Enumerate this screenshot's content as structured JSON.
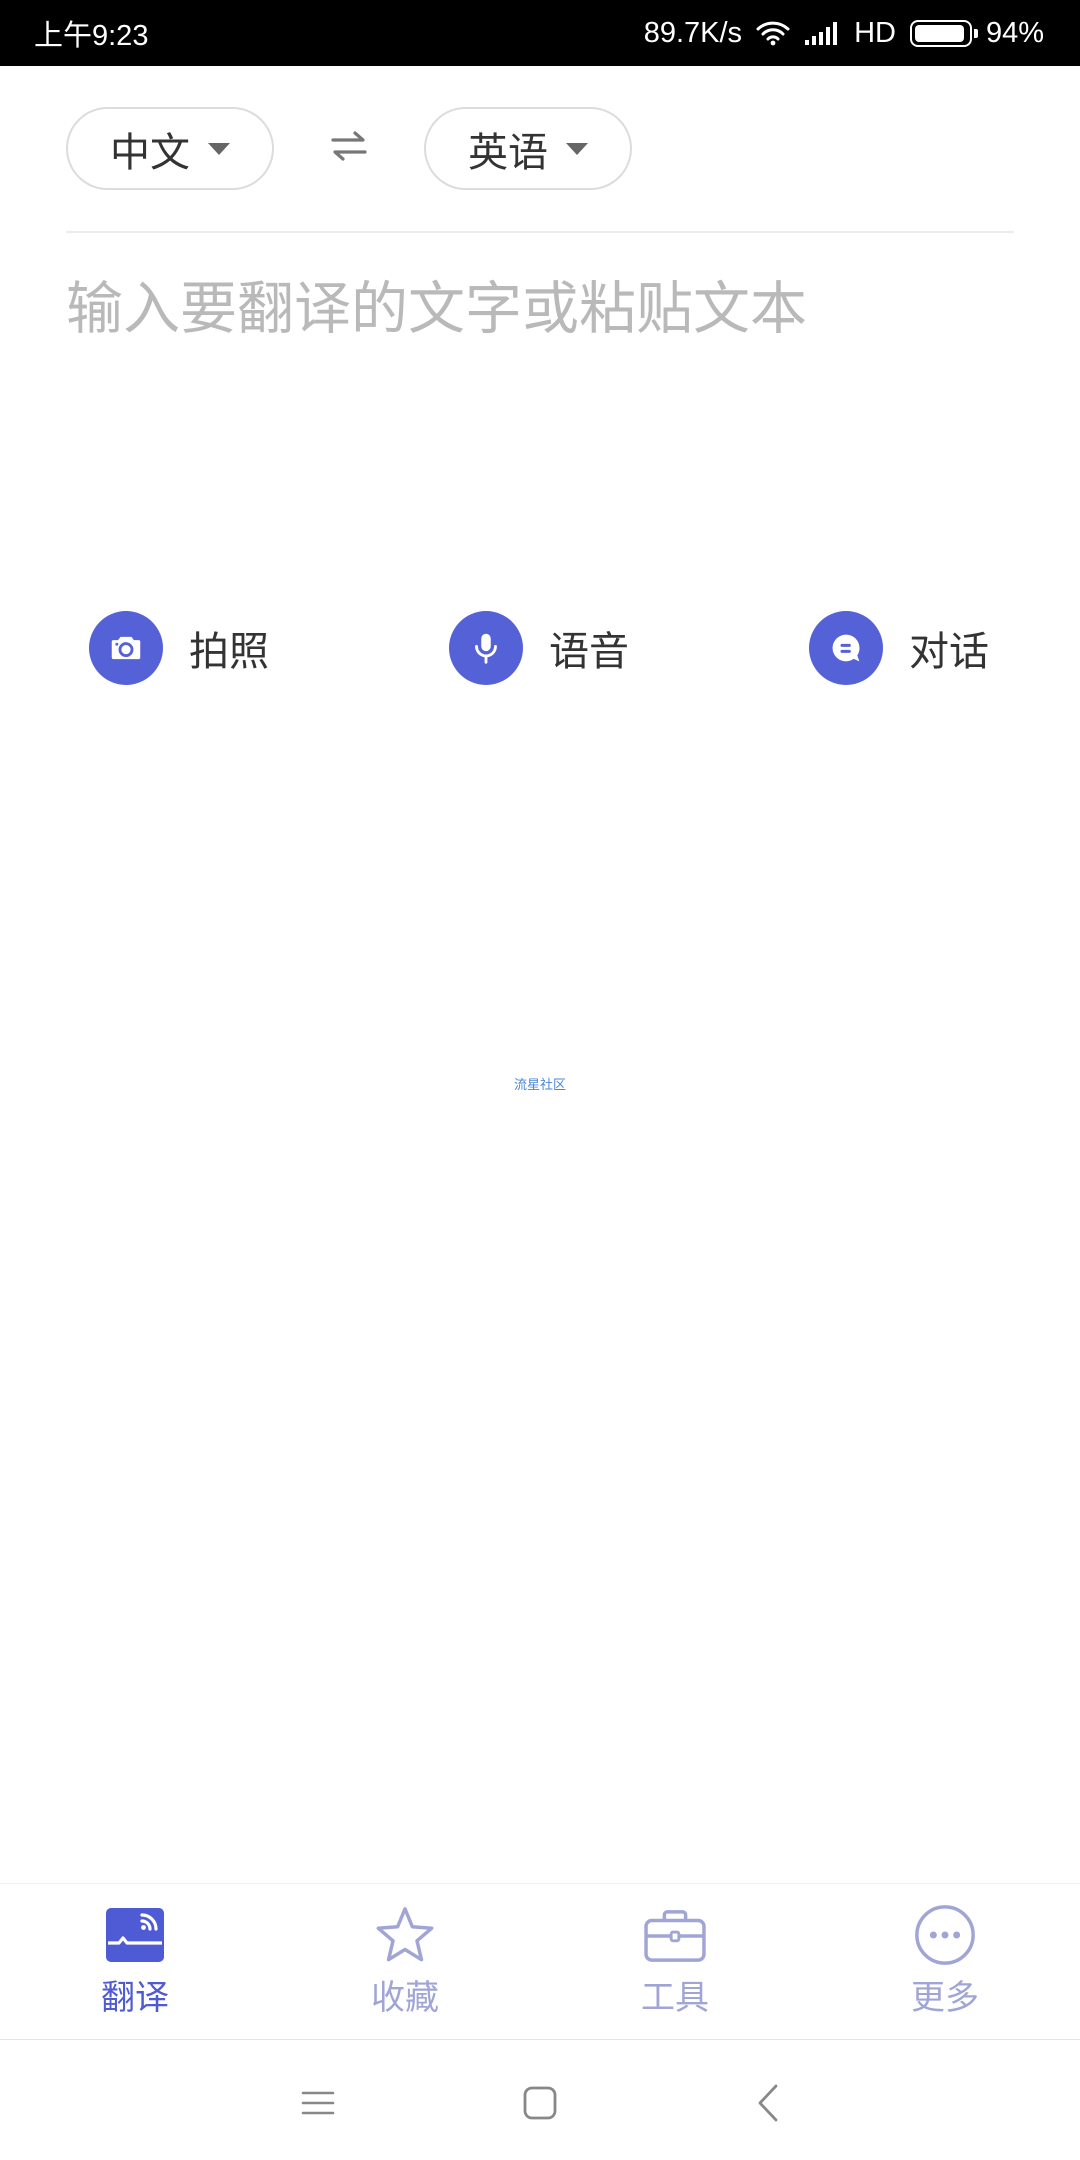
{
  "status_bar": {
    "time": "上午9:23",
    "net_speed": "89.7K/s",
    "network_type": "HD",
    "battery_text": "94%",
    "battery_level": 0.94,
    "icons": [
      "wifi-icon",
      "signal-icon",
      "battery-icon"
    ]
  },
  "language_bar": {
    "source_language": "中文",
    "target_language": "英语",
    "swap_icon": "swap-arrows-icon"
  },
  "input": {
    "placeholder": "输入要翻译的文字或粘贴文本",
    "value": ""
  },
  "actions": [
    {
      "label": "拍照",
      "icon": "camera-icon"
    },
    {
      "label": "语音",
      "icon": "microphone-icon"
    },
    {
      "label": "对话",
      "icon": "chat-icon"
    }
  ],
  "watermark": "流星社区",
  "bottom_nav": {
    "items": [
      {
        "label": "翻译",
        "icon": "translate-icon",
        "active": true
      },
      {
        "label": "收藏",
        "icon": "star-icon",
        "active": false
      },
      {
        "label": "工具",
        "icon": "toolbox-icon",
        "active": false
      },
      {
        "label": "更多",
        "icon": "more-icon",
        "active": false
      }
    ]
  },
  "system_nav": {
    "icons": [
      "menu-icon",
      "home-icon",
      "back-icon"
    ]
  },
  "colors": {
    "accent": "#5561d7",
    "nav_active": "#4f5bd5",
    "nav_inactive": "#a0a5d6",
    "placeholder": "#b9b9b9",
    "status_bar_bg": "#000000",
    "text": "#333333"
  }
}
